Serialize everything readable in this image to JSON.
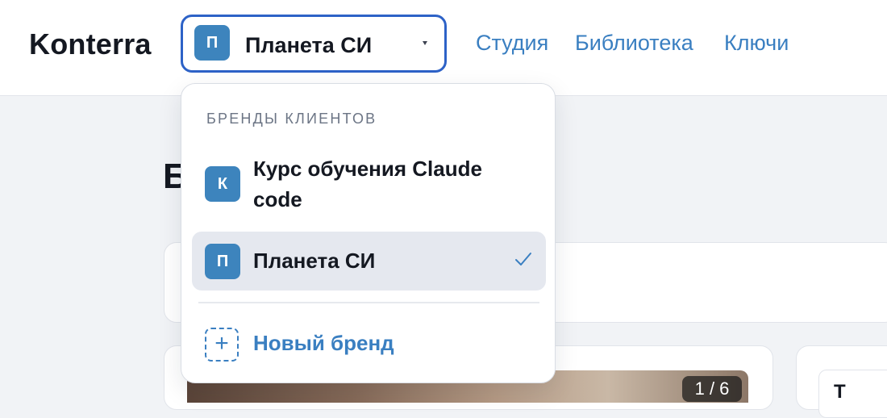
{
  "app": {
    "logo": "Konterra"
  },
  "header": {
    "brand_select": {
      "avatar_letter": "П",
      "value": "Планета СИ"
    },
    "nav": [
      {
        "label": "Студия"
      },
      {
        "label": "Библиотека"
      },
      {
        "label": "Ключи"
      }
    ]
  },
  "page": {
    "title_fragment": "Б",
    "media_counter": "1 / 6",
    "side_snippet": "T"
  },
  "dropdown": {
    "heading": "БРЕНДЫ КЛИЕНТОВ",
    "items": [
      {
        "avatar_letter": "К",
        "label": "Курс обучения Claude code",
        "selected": false
      },
      {
        "avatar_letter": "П",
        "label": "Планета СИ",
        "selected": true
      }
    ],
    "new_brand_label": "Новый бренд",
    "plus_symbol": "+"
  },
  "colors": {
    "accent": "#3a7fc1",
    "select_border": "#2d62c7",
    "avatar_bg": "#3d84bd",
    "selected_bg": "#e5e8ef"
  }
}
